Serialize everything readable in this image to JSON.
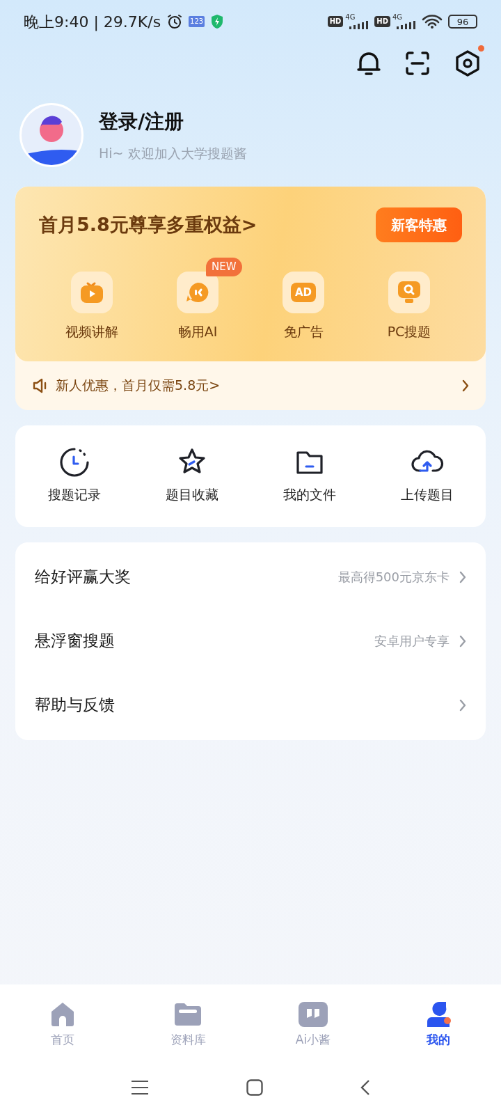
{
  "status_bar": {
    "time": "晚上9:40 | 29.7K/s",
    "app_badge": "123",
    "sims": [
      {
        "badge": "HD",
        "network": "4G"
      },
      {
        "badge": "HD",
        "network": "4G"
      }
    ],
    "battery": "96"
  },
  "header": {
    "settings_dot": true
  },
  "profile": {
    "name": "登录/注册",
    "subtitle": "Hi~ 欢迎加入大学搜题酱"
  },
  "vip": {
    "title": "首月5.8元尊享多重权益>",
    "button": "新客特惠",
    "perks": [
      {
        "kind": "video",
        "label": "视频讲解"
      },
      {
        "kind": "ai",
        "label": "畅用AI",
        "badge": "NEW"
      },
      {
        "kind": "ad",
        "label": "免广告",
        "icon_text": "AD"
      },
      {
        "kind": "pc",
        "label": "PC搜题"
      }
    ],
    "notice": "新人优惠，首月仅需5.8元>"
  },
  "tools": [
    {
      "kind": "history",
      "label": "搜题记录"
    },
    {
      "kind": "star",
      "label": "题目收藏"
    },
    {
      "kind": "folder",
      "label": "我的文件"
    },
    {
      "kind": "upload",
      "label": "上传题目"
    }
  ],
  "menu": [
    {
      "label": "给好评赢大奖",
      "hint": "最高得500元京东卡"
    },
    {
      "label": "悬浮窗搜题",
      "hint": "安卓用户专享"
    },
    {
      "label": "帮助与反馈"
    }
  ],
  "tabs": [
    {
      "kind": "home",
      "label": "首页",
      "selected": false
    },
    {
      "kind": "library",
      "label": "资料库",
      "selected": false
    },
    {
      "kind": "ai",
      "label": "Ai小酱",
      "selected": false
    },
    {
      "kind": "me",
      "label": "我的",
      "selected": true
    }
  ]
}
